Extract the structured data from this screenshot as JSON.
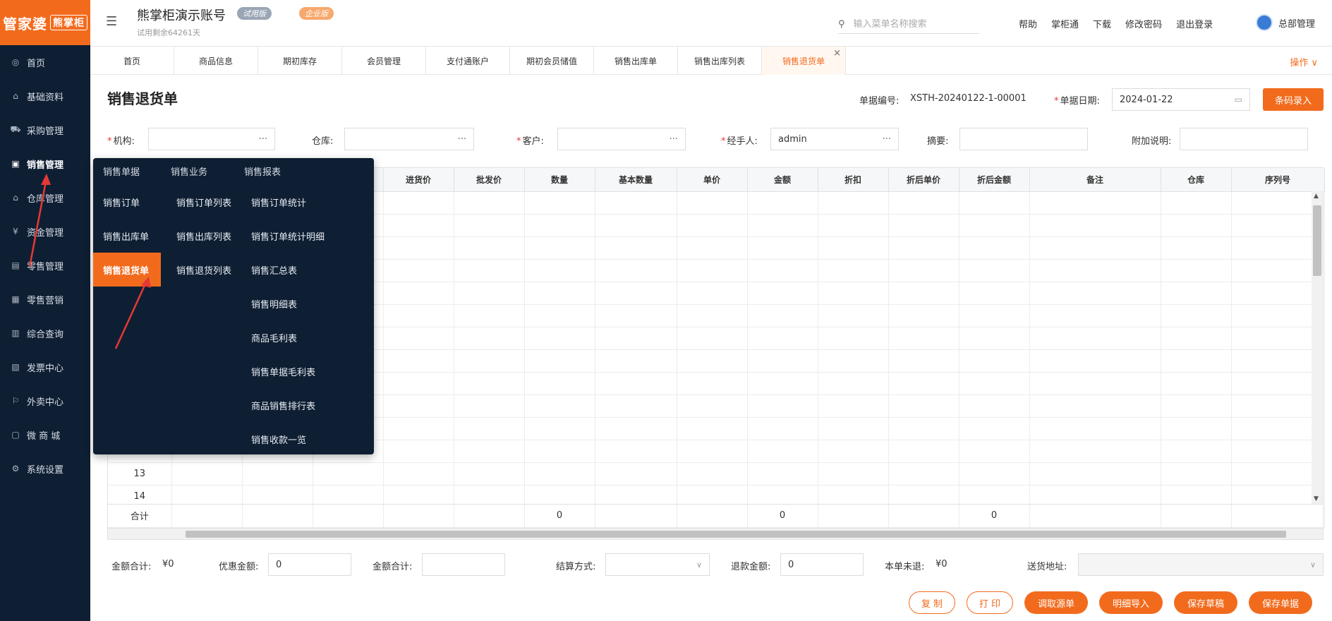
{
  "logo": {
    "text": "管家婆",
    "sub": "熊掌柜"
  },
  "sidebar": {
    "items": [
      {
        "label": "首页",
        "icon": "globe-icon"
      },
      {
        "label": "基础资料",
        "icon": "home-icon"
      },
      {
        "label": "采购管理",
        "icon": "cart-icon"
      },
      {
        "label": "销售管理",
        "icon": "monitor-icon"
      },
      {
        "label": "仓库管理",
        "icon": "bank-icon"
      },
      {
        "label": "资金管理",
        "icon": "yen-icon"
      },
      {
        "label": "零售管理",
        "icon": "chart-icon"
      },
      {
        "label": "零售营销",
        "icon": "gift-icon"
      },
      {
        "label": "综合查询",
        "icon": "bar-chart-icon"
      },
      {
        "label": "发票中心",
        "icon": "invoice-icon"
      },
      {
        "label": "外卖中心",
        "icon": "delivery-icon"
      },
      {
        "label": "微 商 城",
        "icon": "bag-icon"
      },
      {
        "label": "系统设置",
        "icon": "gear-icon"
      }
    ],
    "active_index": 3
  },
  "header": {
    "account_name": "熊掌柜演示账号",
    "trial_badge": "试用版",
    "enterprise_badge": "企业版",
    "trial_remaining": "试用剩余64261天",
    "search_placeholder": "输入菜单名称搜索",
    "links": [
      "帮助",
      "掌柜通",
      "下载",
      "修改密码",
      "退出登录"
    ],
    "user": "总部管理"
  },
  "tabs": {
    "items": [
      "首页",
      "商品信息",
      "期初库存",
      "会员管理",
      "支付通账户",
      "期初会员储值",
      "销售出库单",
      "销售出库列表",
      "销售退货单"
    ],
    "active_index": 8,
    "close_glyph": "×",
    "ops_label": "操作 ∨"
  },
  "page": {
    "title": "销售退货单",
    "doc_no_label": "单据编号:",
    "doc_no": "XSTH-20240122-1-00001",
    "doc_date_label": "单据日期:",
    "doc_date": "2024-01-22",
    "barcode_button": "条码录入"
  },
  "form": {
    "org_label": "机构:",
    "warehouse_label": "仓库:",
    "customer_label": "客户:",
    "handler_label": "经手人:",
    "handler_value": "admin",
    "summary_label": "摘要:",
    "extra_label": "附加说明:",
    "dots": "···"
  },
  "table": {
    "headers": [
      "",
      "",
      "",
      "",
      "进货价",
      "批发价",
      "数量",
      "基本数量",
      "单价",
      "金额",
      "折扣",
      "折后单价",
      "折后金额",
      "备注",
      "仓库",
      "序列号"
    ],
    "visible_row_numbers": [
      "13",
      "14"
    ],
    "total_label": "合计",
    "total_quantity": "0",
    "total_amount": "0",
    "total_discounted_amount": "0"
  },
  "dropdown": {
    "columns": [
      {
        "header": "销售单据",
        "items": [
          "销售订单",
          "销售出库单",
          "销售退货单"
        ]
      },
      {
        "header": "销售业务",
        "items": [
          "销售订单列表",
          "销售出库列表",
          "销售退货列表"
        ]
      },
      {
        "header": "销售报表",
        "items": [
          "销售订单统计",
          "销售订单统计明细",
          "销售汇总表",
          "销售明细表",
          "商品毛利表",
          "销售单据毛利表",
          "商品销售排行表",
          "销售收款一览"
        ]
      }
    ],
    "active_item": "销售退货单"
  },
  "footer": {
    "amount_total_label": "金额合计:",
    "amount_total_value": "¥0",
    "discount_label": "优惠金额:",
    "discount_value": "0",
    "amount_total2_label": "金额合计:",
    "amount_total2_value": "",
    "settle_label": "结算方式:",
    "refund_label": "退款金额:",
    "refund_value": "0",
    "unrefunded_label": "本单未退:",
    "unrefunded_value": "¥0",
    "address_label": "送货地址:",
    "buttons": {
      "copy": "复 制",
      "print": "打 印",
      "fetch": "调取源单",
      "import": "明细导入",
      "draft": "保存草稿",
      "save": "保存单据"
    }
  },
  "colors": {
    "accent": "#f26b1d",
    "sidebar": "#0f1f33"
  }
}
